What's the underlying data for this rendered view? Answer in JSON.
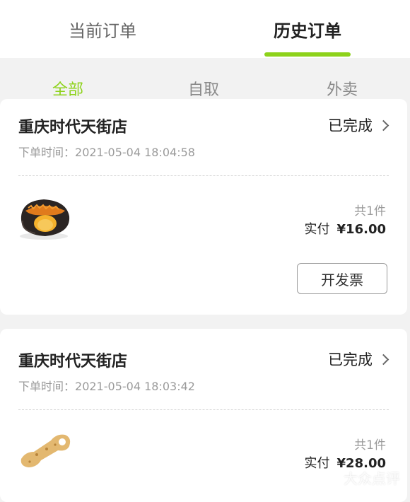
{
  "top_tabs": [
    {
      "label": "当前订单",
      "active": false
    },
    {
      "label": "历史订单",
      "active": true
    }
  ],
  "sub_tabs": [
    {
      "label": "全部",
      "active": true
    },
    {
      "label": "自取",
      "active": false
    },
    {
      "label": "外卖",
      "active": false
    }
  ],
  "orders": [
    {
      "store": "重庆时代天街店",
      "status": "已完成",
      "time_label": "下单时间：",
      "time": "2021-05-04 18:04:58",
      "qty": "共1件",
      "paid_label": "实付",
      "amount": "¥16.00",
      "invoice_label": "开发票"
    },
    {
      "store": "重庆时代天街店",
      "status": "已完成",
      "time_label": "下单时间：",
      "time": "2021-05-04 18:03:42",
      "qty": "共1件",
      "paid_label": "实付",
      "amount": "¥28.00"
    }
  ],
  "watermark": "大众点评",
  "colors": {
    "accent": "#8dd21a",
    "page_bg": "#f2f2f2"
  }
}
